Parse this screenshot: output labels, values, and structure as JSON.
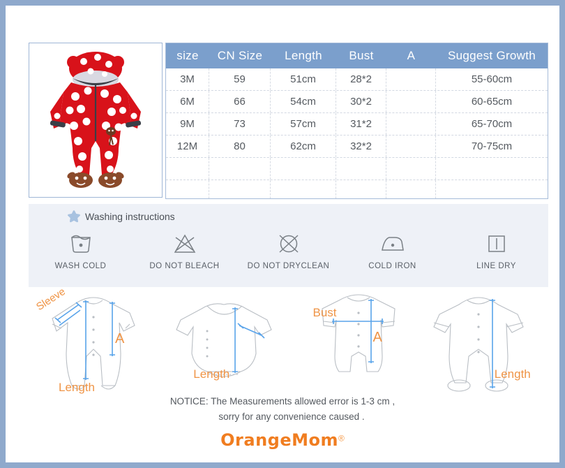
{
  "product_photo": {
    "alt": "red polka dot hooded baby snowsuit romper with animal face feet",
    "colors": {
      "garment": "#d8121a",
      "dot": "#ffffff",
      "trim": "#3a3f47",
      "face": "#8a4a2a"
    }
  },
  "size_table": {
    "headers": [
      "size",
      "CN Size",
      "Length",
      "Bust",
      "A",
      "Suggest Growth"
    ],
    "rows": [
      [
        "3M",
        "59",
        "51cm",
        "28*2",
        "",
        "55-60cm"
      ],
      [
        "6M",
        "66",
        "54cm",
        "30*2",
        "",
        "60-65cm"
      ],
      [
        "9M",
        "73",
        "57cm",
        "31*2",
        "",
        "65-70cm"
      ],
      [
        "12M",
        "80",
        "62cm",
        "32*2",
        "",
        "70-75cm"
      ],
      [
        "",
        "",
        "",
        "",
        "",
        ""
      ],
      [
        "",
        "",
        "",
        "",
        "",
        ""
      ]
    ],
    "header_color": "#7b9fcc"
  },
  "washing": {
    "title": "Washing instructions",
    "star_icon": "star-icon",
    "panel_color": "#eef1f7",
    "icons": [
      {
        "label": "WASH COLD",
        "icon": "wash-tub-icon"
      },
      {
        "label": "DO NOT BLEACH",
        "icon": "no-bleach-triangle-icon"
      },
      {
        "label": "DO NOT DRYCLEAN",
        "icon": "no-dryclean-circle-icon"
      },
      {
        "label": "COLD IRON",
        "icon": "iron-icon"
      },
      {
        "label": "LINE DRY",
        "icon": "line-dry-square-icon"
      }
    ]
  },
  "diagrams": [
    {
      "name": "footed-romper-front",
      "labels": [
        "Sleeve",
        "A",
        "Length"
      ]
    },
    {
      "name": "bodysuit-long-sleeve",
      "labels": [
        "Length"
      ]
    },
    {
      "name": "short-sleeve-romper",
      "labels": [
        "Bust",
        "A"
      ]
    },
    {
      "name": "footed-sleepsuit",
      "labels": [
        "Length"
      ]
    }
  ],
  "notice": {
    "line1": "NOTICE:   The Measurements allowed error is 1-3 cm ,",
    "line2": "sorry for any convenience caused ."
  },
  "logo": {
    "word": "OrangeMom",
    "registered": "®",
    "color": "#f07d20"
  },
  "frame": {
    "outer_color": "#8fa9cc",
    "inner_color": "#ffffff"
  }
}
